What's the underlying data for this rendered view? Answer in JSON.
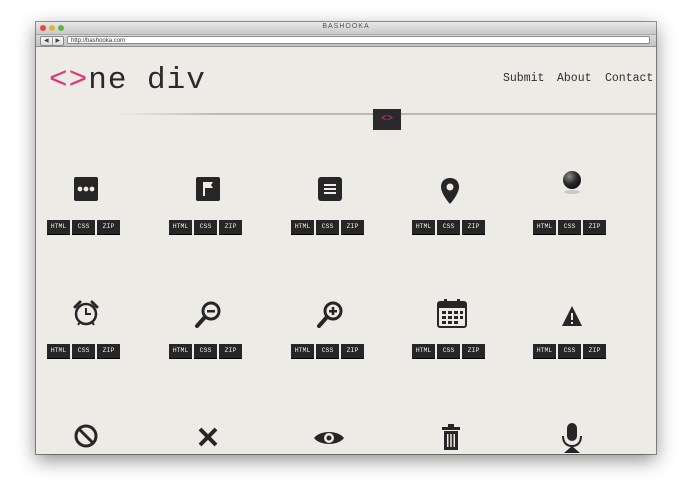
{
  "window": {
    "title": "BASHOOKA",
    "url": "http://bashooka.com",
    "back_label": "◀",
    "forward_label": "▶"
  },
  "site": {
    "logo_mark": "<>",
    "logo_text": "ne div",
    "nav": [
      "Submit",
      "About",
      "Contact"
    ],
    "badge": "<>",
    "accent_color": "#e0357a",
    "text_color": "#262626",
    "background_color": "#ecebe6"
  },
  "download_labels": [
    "HTML",
    "CSS",
    "ZIP"
  ],
  "icons": [
    {
      "name": "more-dots-icon"
    },
    {
      "name": "flag-icon"
    },
    {
      "name": "list-icon"
    },
    {
      "name": "map-pin-icon"
    },
    {
      "name": "sphere-icon"
    },
    {
      "name": "alarm-clock-icon"
    },
    {
      "name": "zoom-out-icon"
    },
    {
      "name": "zoom-in-icon"
    },
    {
      "name": "calendar-icon"
    },
    {
      "name": "warning-icon"
    },
    {
      "name": "prohibited-icon"
    },
    {
      "name": "close-x-icon"
    },
    {
      "name": "eye-icon"
    },
    {
      "name": "trash-icon"
    },
    {
      "name": "microphone-icon"
    }
  ]
}
